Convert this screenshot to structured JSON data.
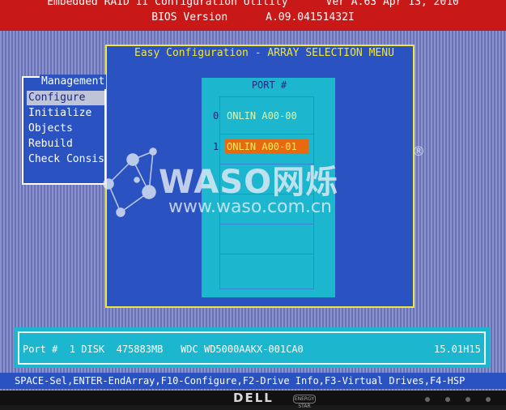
{
  "header": {
    "line1": "Embedded RAID II Configuration Utility      Ver A.63 Apr 13, 2010",
    "line2": "BIOS Version      A.09.04151432I"
  },
  "menu": {
    "title": "Easy Configuration - ARRAY SELECTION MENU"
  },
  "management": {
    "title": "Management",
    "items": [
      {
        "label": "Configure",
        "selected": true
      },
      {
        "label": "Initialize",
        "selected": false
      },
      {
        "label": "Objects",
        "selected": false
      },
      {
        "label": "Rebuild",
        "selected": false
      },
      {
        "label": "Check Consis",
        "selected": false
      }
    ]
  },
  "ports": {
    "header": "PORT #",
    "drives": [
      {
        "port": "0",
        "label": "ONLIN A00-00",
        "selected": false
      },
      {
        "port": "1",
        "label": "ONLIN A00-01",
        "selected": true
      }
    ]
  },
  "status": {
    "info": "Port #  1 DISK  475883MB   WDC WD5000AAKX-001CA0",
    "version": "15.01H15"
  },
  "help": {
    "text": "SPACE-Sel,ENTER-EndArray,F10-Configure,F2-Drive Info,F3-Virtual Drives,F4-HSP"
  },
  "bezel": {
    "brand": "DELL",
    "energy": "ENERGY STAR"
  },
  "watermark": {
    "brand": "WASO网烁",
    "url": "www.waso.com.cn",
    "reg": "®"
  },
  "colors": {
    "title_bar": "#c81818",
    "menu_bg": "#2a52c0",
    "menu_border": "#f0e640",
    "panel_cyan": "#1cb6ce",
    "highlight_orange": "#e86a10",
    "online_green": "#d8f6b0"
  }
}
